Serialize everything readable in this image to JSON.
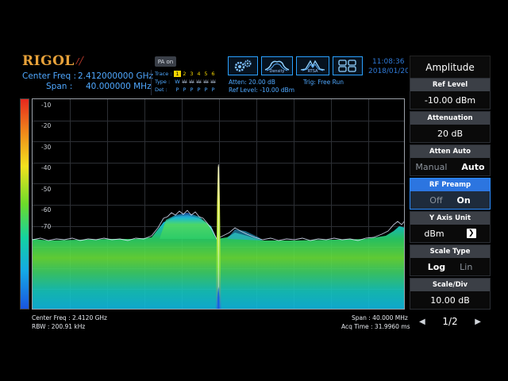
{
  "header": {
    "brand": "RIGOL",
    "center_freq_label": "Center Freq :",
    "center_freq_value": "2.412000000 GHz",
    "span_label": "Span :",
    "span_value": "40.000000 MHz",
    "pa_label": "PA on",
    "trace": {
      "trace_label": "Trace :",
      "type_label": "Type :",
      "det_label": "Det :",
      "numbers": [
        "1",
        "2",
        "3",
        "4",
        "5",
        "6"
      ],
      "types": [
        "W",
        "W",
        "W",
        "W",
        "W",
        "W"
      ],
      "dets": [
        "P",
        "P",
        "P",
        "P",
        "P",
        "P"
      ]
    },
    "atten": "Atten: 20.00 dB",
    "ref_level": "Ref Level: -10.00 dBm",
    "trig": "Trig: Free Run",
    "mode_buttons": [
      {
        "name": "settings",
        "caption": ""
      },
      {
        "name": "density",
        "caption": "Density"
      },
      {
        "name": "rtsa",
        "caption": "RTSA"
      },
      {
        "name": "layout",
        "caption": ""
      }
    ],
    "time": "11:08:36",
    "date": "2018/01/20"
  },
  "plot": {
    "y_ticks": [
      "-10",
      "-20",
      "-30",
      "-40",
      "-50",
      "-60",
      "-70"
    ]
  },
  "footer": {
    "center_freq": "Center Freq : 2.4120 GHz",
    "rbw": "RBW : 200.91 kHz",
    "span": "Span : 40.000 MHz",
    "acq_time": "Acq Time : 31.9960 ms"
  },
  "menu": {
    "title": "Amplitude",
    "items": [
      {
        "label": "Ref Level",
        "value": "-10.00 dBm"
      },
      {
        "label": "Attenuation",
        "value": "20 dB"
      },
      {
        "label": "Atten Auto",
        "opt_a": "Manual",
        "opt_b": "Auto"
      },
      {
        "label": "RF Preamp",
        "opt_a": "Off",
        "opt_b": "On"
      },
      {
        "label": "Y Axis Unit",
        "value": "dBm"
      },
      {
        "label": "Scale Type",
        "opt_a": "Log",
        "opt_b": "Lin"
      },
      {
        "label": "Scale/Div",
        "value": "10.00 dB"
      }
    ],
    "page": "1/2"
  },
  "colors": {
    "accent": "#2c75e0",
    "label_blue": "#4fa8ff",
    "brand_orange": "#e8a23a"
  }
}
